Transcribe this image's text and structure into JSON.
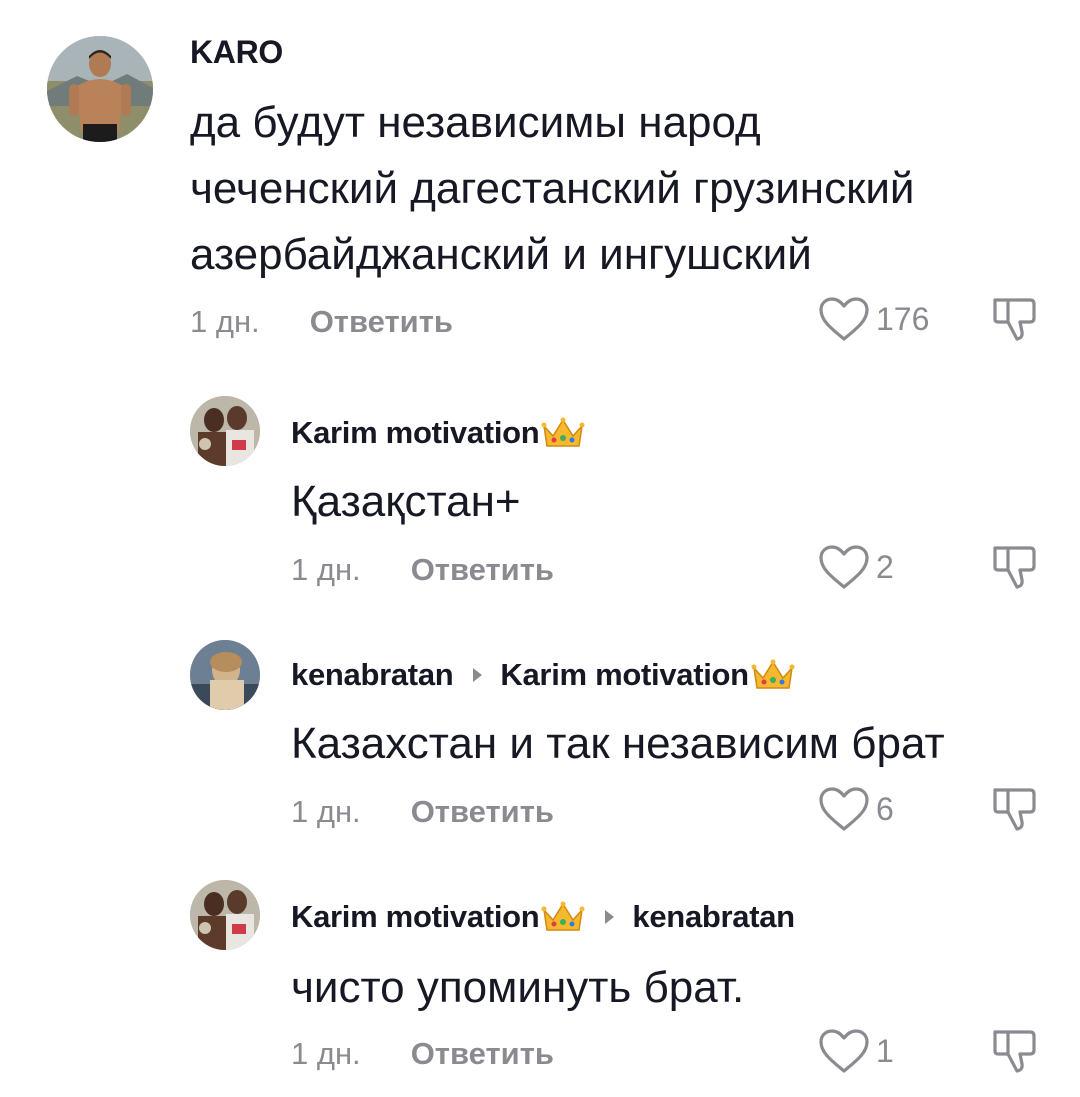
{
  "comments": [
    {
      "username": "KARO",
      "has_crown": false,
      "reply_to": "",
      "text": "да будут независимы народ\nчеченский дагестанский грузинский\nазербайджанский и ингушский",
      "time": "1 дн.",
      "reply_label": "Ответить",
      "likes": "176"
    },
    {
      "username": "Karim motivation",
      "has_crown": true,
      "reply_to": "",
      "text": "Қазақстан+",
      "time": "1 дн.",
      "reply_label": "Ответить",
      "likes": "2"
    },
    {
      "username": "kenabratan",
      "has_crown": false,
      "reply_to": "Karim motivation",
      "reply_to_has_crown": true,
      "text": "Казахстан и так независим брат",
      "time": "1 дн.",
      "reply_label": "Ответить",
      "likes": "6"
    },
    {
      "username": "Karim motivation",
      "has_crown": true,
      "reply_to": "kenabratan",
      "text": "чисто упоминуть брат.",
      "time": "1 дн.",
      "reply_label": "Ответить",
      "likes": "1"
    }
  ],
  "icons": {
    "like": "heart-outline-icon",
    "dislike": "thumbs-down-icon",
    "crown": "crown-emoji",
    "reply_arrow": "caret-right-icon"
  },
  "colors": {
    "text": "#161823",
    "secondary": "#8a8b91"
  }
}
